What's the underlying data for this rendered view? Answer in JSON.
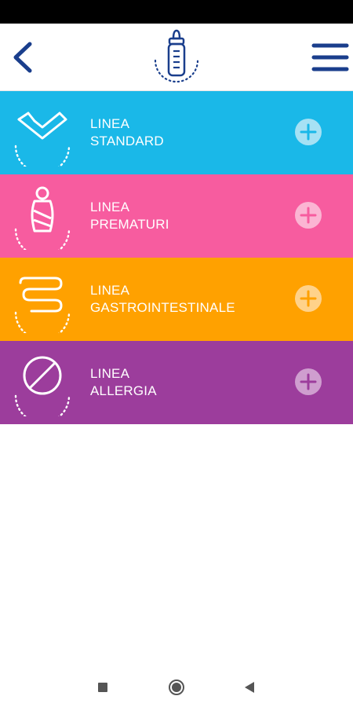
{
  "header": {
    "back_icon": "chevron-left-icon",
    "logo_icon": "baby-bottle-icon",
    "menu_icon": "hamburger-menu-icon",
    "accent_color": "#1a3e8c"
  },
  "lines": [
    {
      "title_line1": "LINEA",
      "title_line2": "STANDARD",
      "color": "#1ab8e8",
      "icon": "heart-check-icon",
      "plus_icon": "plus-circle-icon"
    },
    {
      "title_line1": "LINEA",
      "title_line2": "PREMATURI",
      "color": "#f75c9f",
      "icon": "swaddled-baby-icon",
      "plus_icon": "plus-circle-icon"
    },
    {
      "title_line1": "LINEA",
      "title_line2": "GASTROINTESTINALE",
      "color": "#ffa100",
      "icon": "intestine-icon",
      "plus_icon": "plus-circle-icon"
    },
    {
      "title_line1": "LINEA",
      "title_line2": "ALLERGIA",
      "color": "#9c3d9c",
      "icon": "prohibited-icon",
      "plus_icon": "plus-circle-icon"
    }
  ],
  "navbar": {
    "recents_icon": "square-icon",
    "home_icon": "circle-icon",
    "back_icon": "triangle-back-icon"
  }
}
